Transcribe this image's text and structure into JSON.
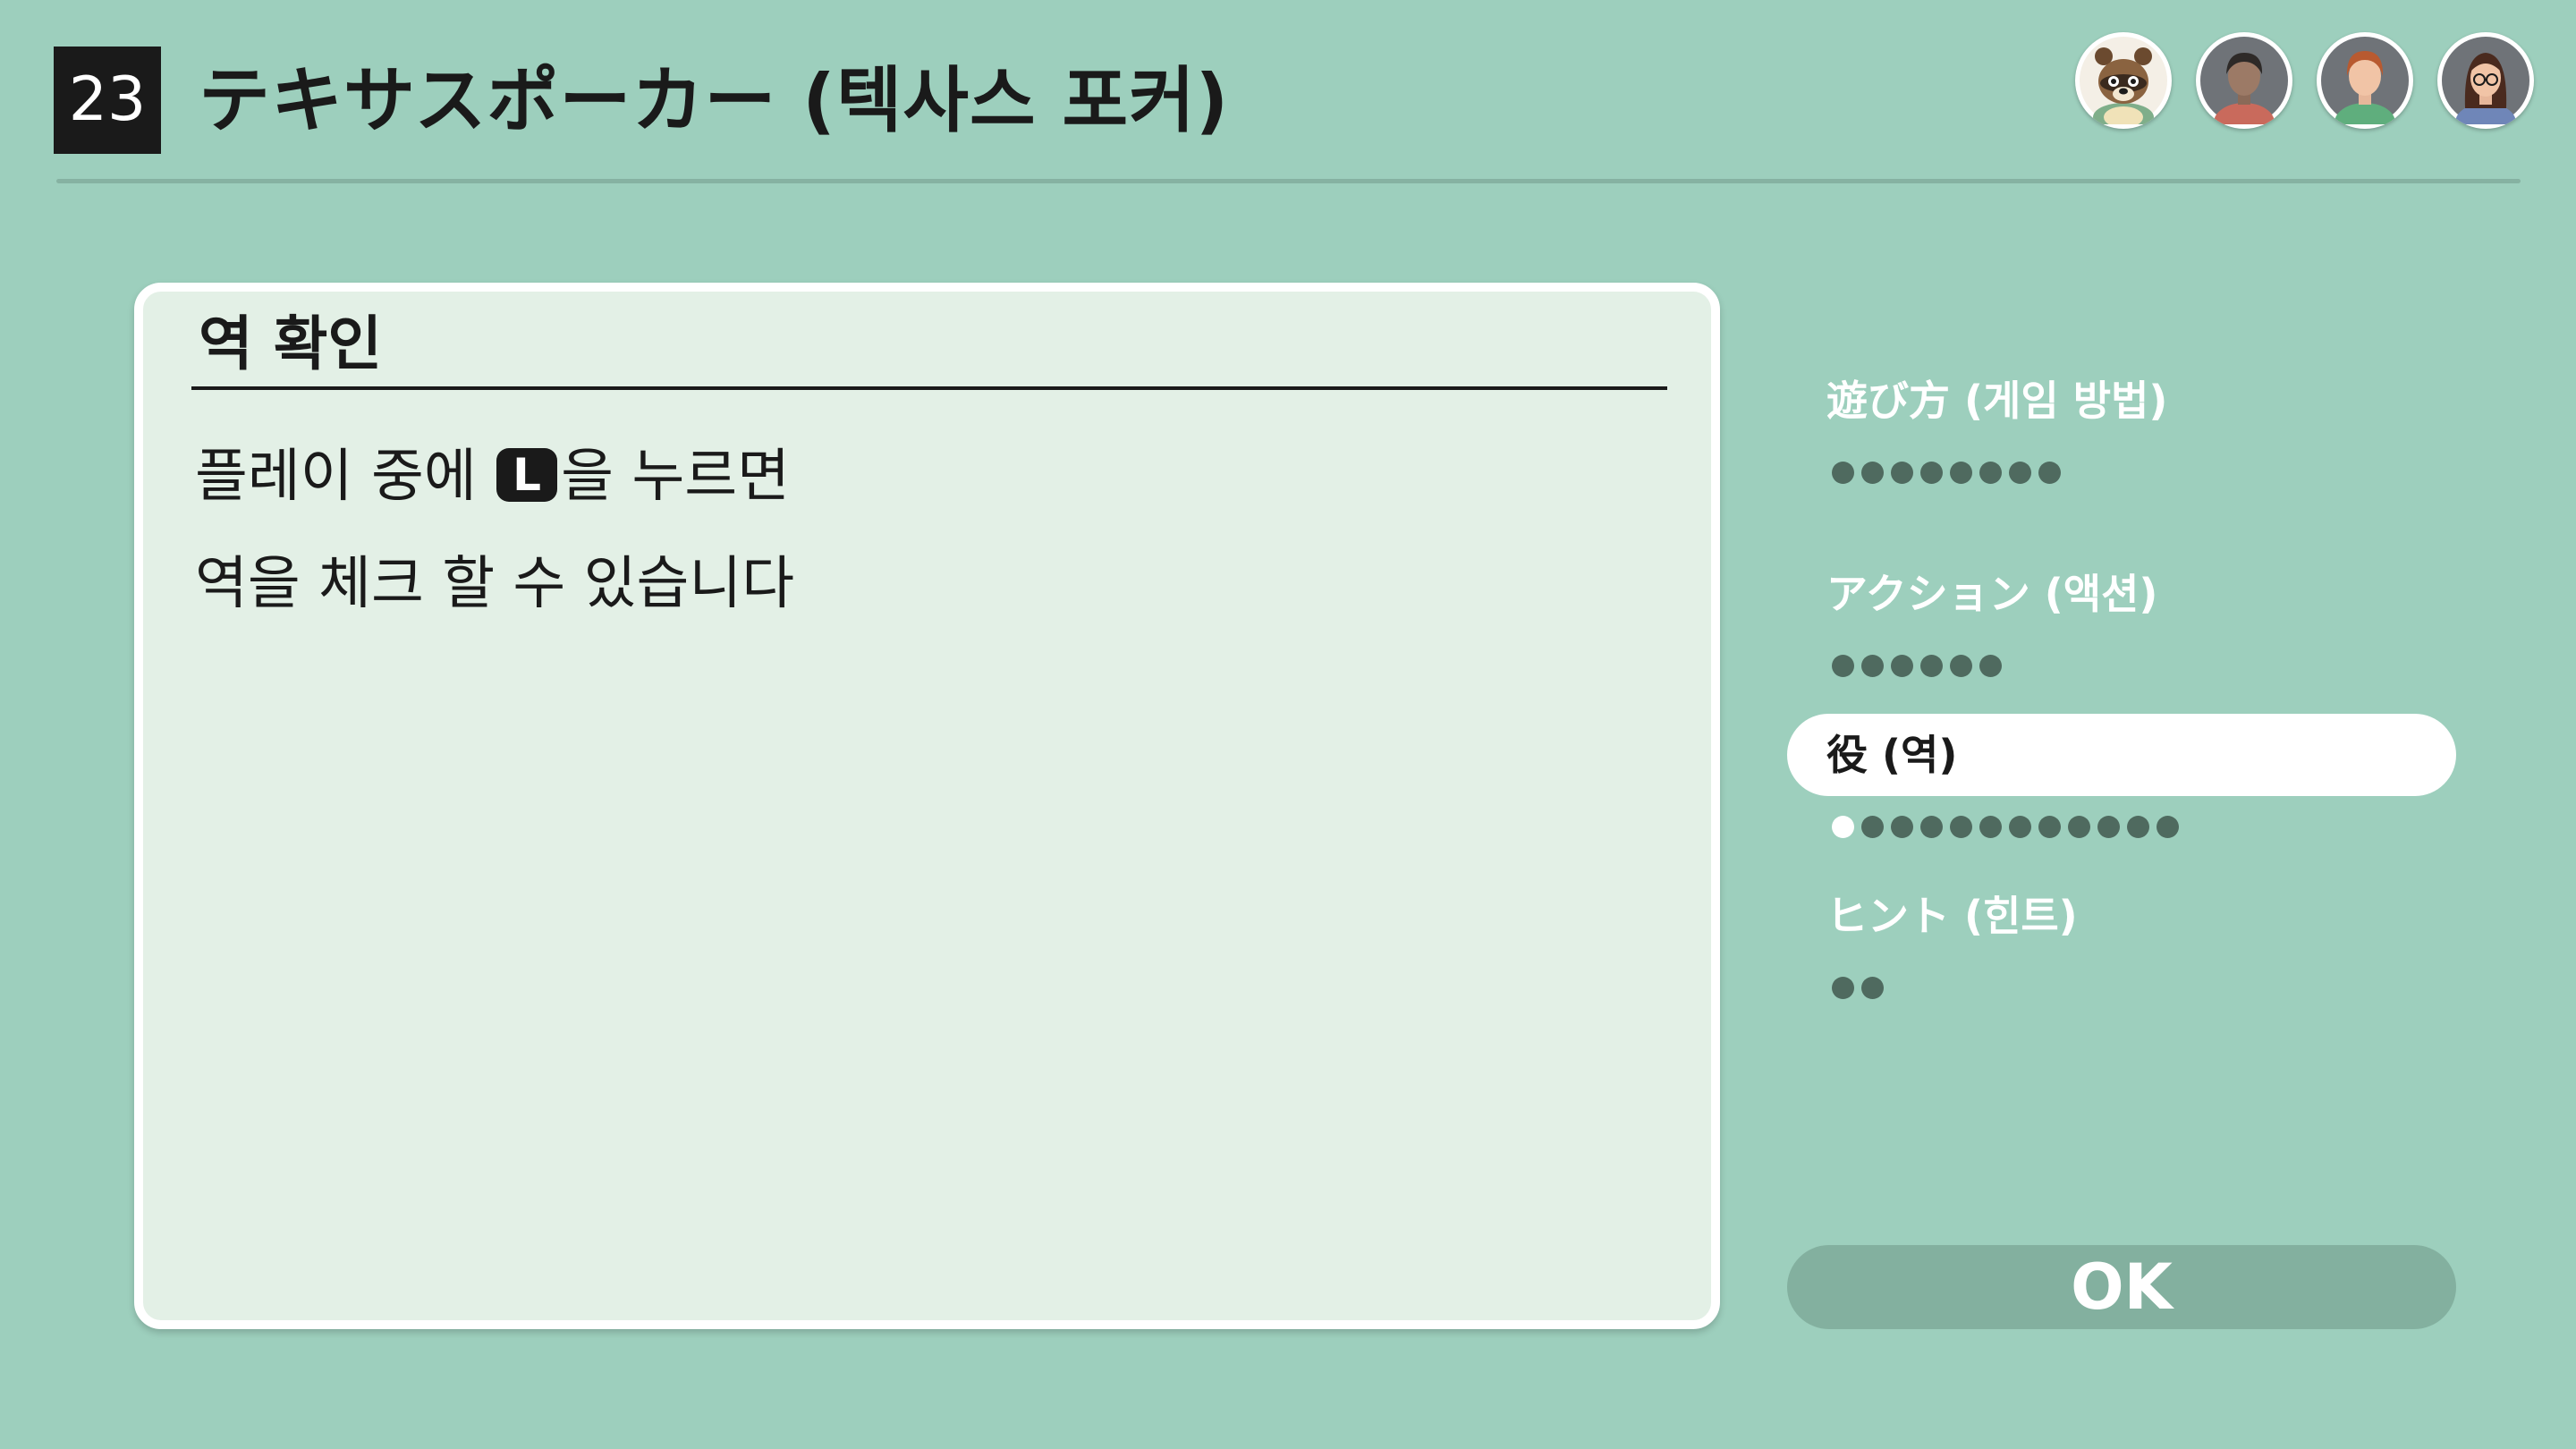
{
  "header": {
    "game_number": "23",
    "title": "テキサスポーカー (텍사스 포커)"
  },
  "players": [
    {
      "name": "tom-nook-avatar"
    },
    {
      "name": "player-avatar-dark-hair"
    },
    {
      "name": "player-avatar-auburn-hair"
    },
    {
      "name": "player-avatar-glasses"
    }
  ],
  "panel": {
    "title": "역 확인",
    "line1_before": "플레이 중에 ",
    "button_glyph": "L",
    "line1_after": "을 누르면",
    "line2": "역을 체크 할 수 있습니다"
  },
  "menu": {
    "items": [
      {
        "label": "遊び方 (게임 방법)",
        "pages": 8,
        "current_page": null
      },
      {
        "label": "アクション (액션)",
        "pages": 6,
        "current_page": null
      },
      {
        "label": "役 (역)",
        "pages": 12,
        "current_page": 1
      },
      {
        "label": "ヒント (힌트)",
        "pages": 2,
        "current_page": null
      }
    ],
    "active_index": 2
  },
  "ok_label": "OK",
  "colors": {
    "background": "#9dcfbd",
    "panel": "#e3f0e6",
    "dot": "#4f6a5f",
    "ok_button": "#83b09f"
  }
}
